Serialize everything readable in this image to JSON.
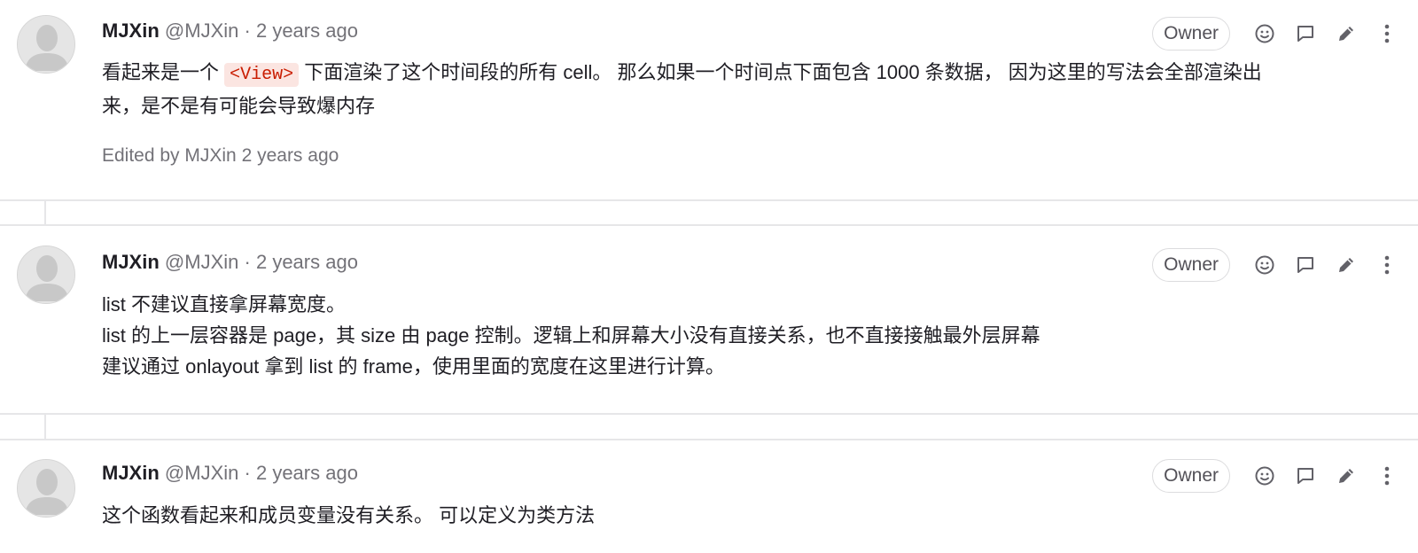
{
  "notes": [
    {
      "author": "MJXin",
      "handle": "@MJXin",
      "separator": "·",
      "time": "2 years ago",
      "badge": "Owner",
      "body_line1_before": "看起来是一个",
      "body_code": "<View>",
      "body_line1_after": "下面渲染了这个时间段的所有 cell。 那么如果一个时间点下面包含 1000 条数据， 因为这里的写法会全部渲染出",
      "body_line2": "来，是不是有可能会导致爆内存",
      "edited": "Edited by MJXin 2 years ago"
    },
    {
      "author": "MJXin",
      "handle": "@MJXin",
      "separator": "·",
      "time": "2 years ago",
      "badge": "Owner",
      "body_lines": [
        "list 不建议直接拿屏幕宽度。",
        "list 的上一层容器是 page，其 size 由 page 控制。逻辑上和屏幕大小没有直接关系，也不直接接触最外层屏幕",
        "建议通过 onlayout 拿到 list 的 frame，使用里面的宽度在这里进行计算。"
      ]
    },
    {
      "author": "MJXin",
      "handle": "@MJXin",
      "separator": "·",
      "time": "2 years ago",
      "badge": "Owner",
      "body_lines": [
        "这个函数看起来和成员变量没有关系。 可以定义为类方法"
      ]
    }
  ],
  "icons": {
    "reaction": "smiley-icon",
    "reply": "comment-icon",
    "edit": "pencil-icon",
    "more": "kebab-icon"
  },
  "colors": {
    "text": "#1f1e24",
    "muted": "#737278",
    "code_text": "#c91c00",
    "code_bg": "#fbe5e1",
    "border": "#e6e6e8"
  }
}
